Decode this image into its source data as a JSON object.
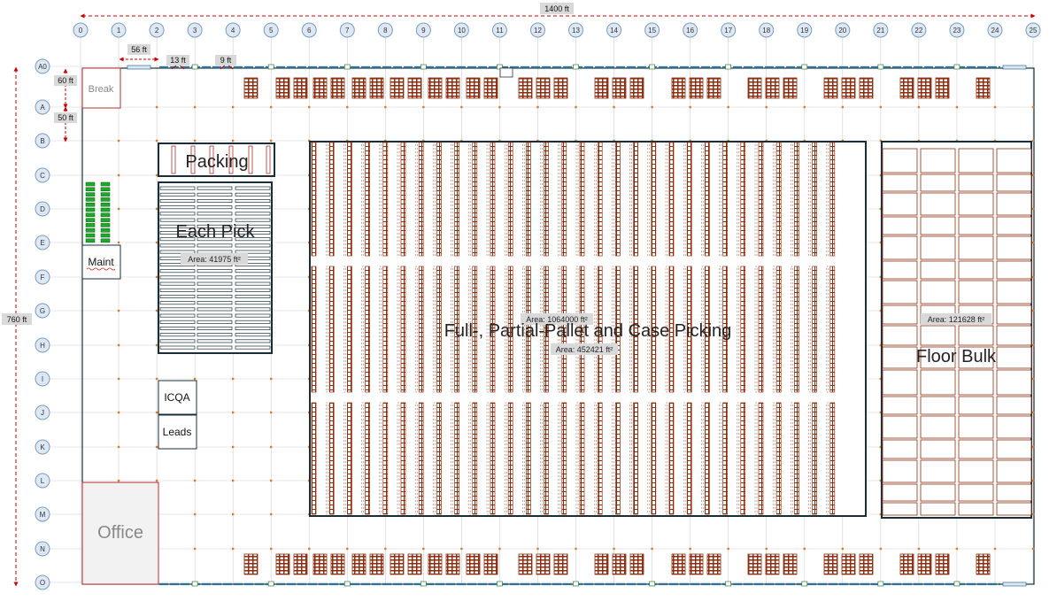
{
  "dimensions": {
    "width_label": "1400 ft",
    "height_label": "760 ft",
    "row_a0_a": "60 ft",
    "row_a_b": "50 ft",
    "col_span": "56 ft",
    "small_1": "13 ft",
    "small_2": "9 ft"
  },
  "columns": [
    "0",
    "1",
    "2",
    "3",
    "4",
    "5",
    "6",
    "7",
    "8",
    "9",
    "10",
    "11",
    "12",
    "13",
    "14",
    "15",
    "16",
    "17",
    "18",
    "19",
    "20",
    "21",
    "22",
    "23",
    "24",
    "25"
  ],
  "rows": [
    "A0",
    "A",
    "B",
    "C",
    "D",
    "E",
    "F",
    "G",
    "H",
    "I",
    "J",
    "K",
    "L",
    "M",
    "N",
    "O"
  ],
  "zones": {
    "break": "Break",
    "packing": "Packing",
    "each_pick": "Each Pick",
    "maint": "Maint",
    "icqa": "ICQA",
    "leads": "Leads",
    "office": "Office",
    "main_picking": "Full-, Partial-Pallet and Case Picking",
    "floor_bulk": "Floor Bulk"
  },
  "areas": {
    "each_pick": "Area: 41975 ft²",
    "main_total": "Area: 1064000 ft²",
    "main_picking": "Area: 452421 ft²",
    "floor_bulk": "Area: 121628 ft²"
  },
  "colors": {
    "rack": "#8b2e0f",
    "wall": "#1a2e3a",
    "dimension": "#cc0000",
    "grid": "#c8c8c8",
    "bubble_fill": "#dde8f4",
    "bubble_stroke": "#7a9cc0",
    "battery": "#1fa82b"
  }
}
